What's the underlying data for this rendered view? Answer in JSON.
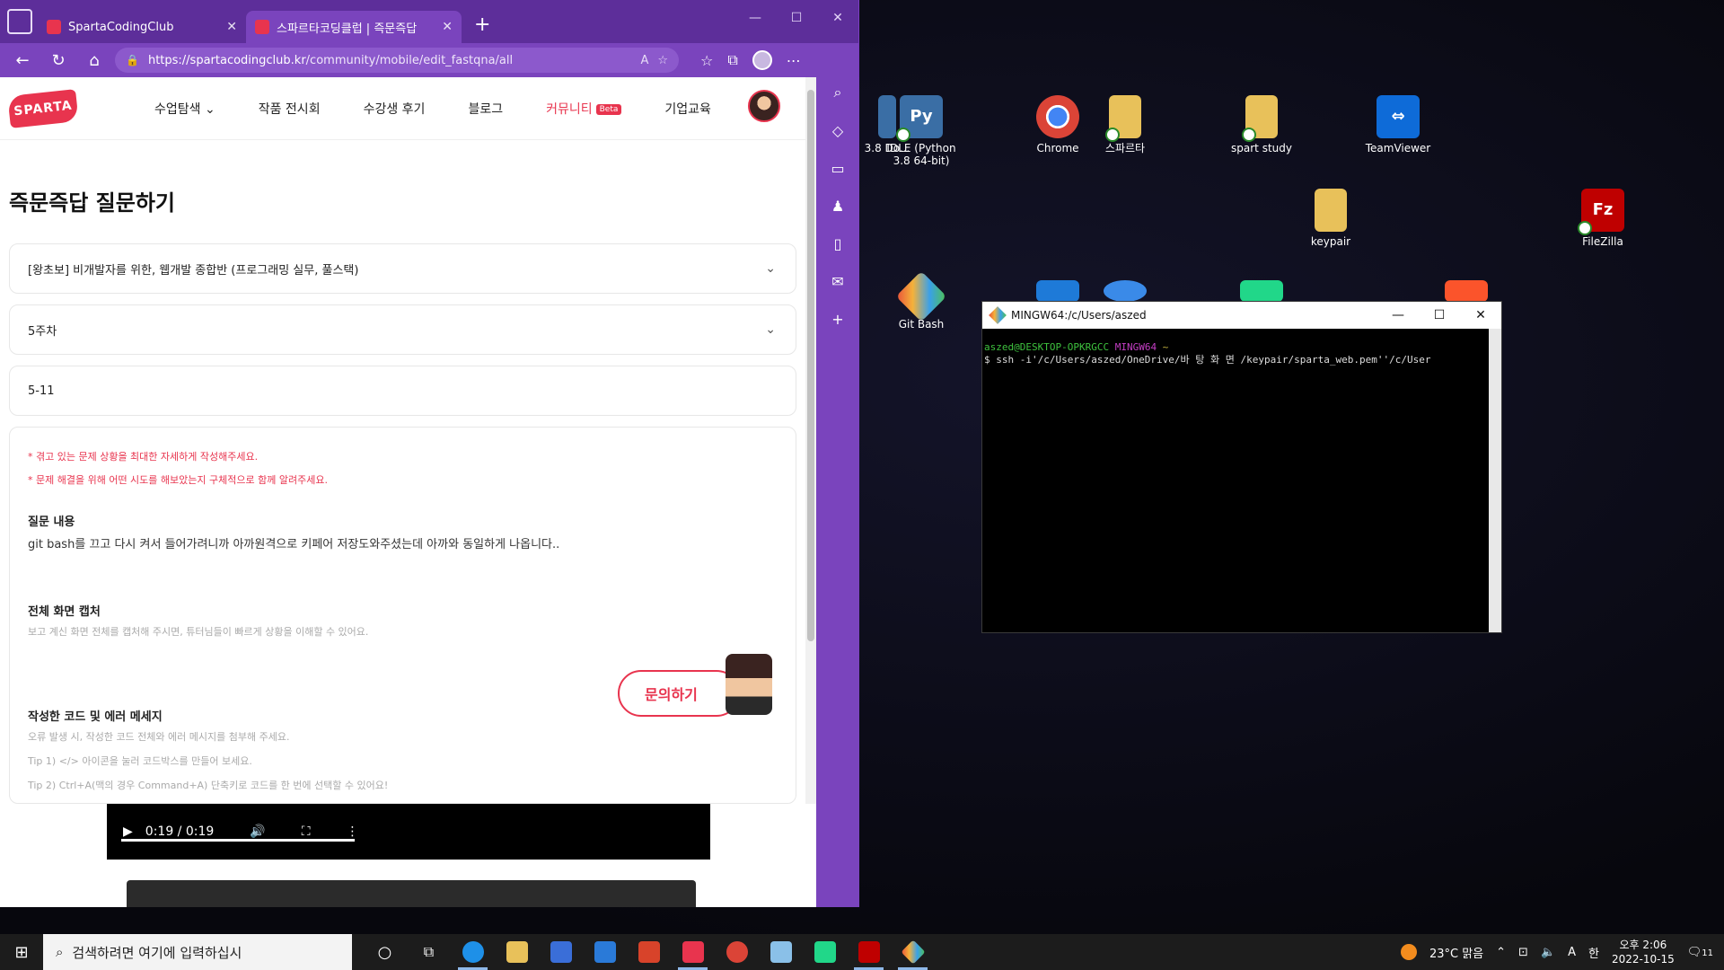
{
  "browser": {
    "tabs": [
      {
        "label": "SpartaCodingClub",
        "active": false
      },
      {
        "label": "스파르타코딩클럽 | 즉문즉답",
        "active": true
      }
    ],
    "url_host": "https://spartacodingclub.kr",
    "url_path": "/community/mobile/edit_fastqna/all"
  },
  "site": {
    "logo": "SPARTA",
    "nav": [
      {
        "label": "수업탐색"
      },
      {
        "label": "작품 전시회"
      },
      {
        "label": "수강생 후기"
      },
      {
        "label": "블로그"
      },
      {
        "label": "커뮤니티",
        "badge": "Beta"
      },
      {
        "label": "기업교육"
      }
    ]
  },
  "form": {
    "title": "즉문즉답 질문하기",
    "course": "[왕초보] 비개발자를 위한, 웹개발 종합반 (프로그래밍 실무, 풀스택)",
    "week": "5주차",
    "lesson": "5-11",
    "warnings": [
      "* 겪고 있는 문제 상황을 최대한 자세하게 작성해주세요.",
      "* 문제 해결을 위해 어떤 시도를 해보았는지 구체적으로 함께 알려주세요."
    ],
    "question_heading": "질문 내용",
    "question_text": "git bash를 끄고 다시 켜서 들어가려니까 아까원격으로 키페어 저장도와주셨는데 아까와 동일하게 나옵니다..",
    "capture_heading": "전체 화면 캡처",
    "capture_hint": "보고 계신 화면 전체를 캡처해 주시면, 튜터님들이 빠르게 상황을 이해할 수 있어요.",
    "code_heading": "작성한 코드 및 에러 메세지",
    "code_hints": [
      "오류 발생 시, 작성한 코드 전체와 에러 메시지를 첨부해 주세요.",
      "Tip 1) </> 아이콘을 눌러 코드박스를 만들어 보세요.",
      "Tip 2) Ctrl+A(맥의 경우 Command+A) 단축키로 코드를 한 번에 선택할 수 있어요!"
    ],
    "ask_button": "문의하기"
  },
  "video": {
    "time": "0:19 / 0:19"
  },
  "desktop_icons": [
    {
      "label": "3.8 Do...",
      "color": "#3a6ea5"
    },
    {
      "label": "IDLE (Python 3.8 64-bit)",
      "color": "#3a6ea5"
    },
    {
      "label": "Chrome",
      "color": "#db4437"
    },
    {
      "label": "스파르타",
      "color": "#e8c15a"
    },
    {
      "label": "spart study",
      "color": "#e8c15a"
    },
    {
      "label": "TeamViewer",
      "color": "#0e6bd8"
    },
    {
      "label": "keypair",
      "color": "#e8c15a"
    },
    {
      "label": "FileZilla",
      "color": "#bf0000"
    },
    {
      "label": "Git Bash",
      "color": "#e84e3a"
    }
  ],
  "terminal": {
    "title": "MINGW64:/c/Users/aszed",
    "prompt_user": "aszed@DESKTOP-OPKRGCC",
    "prompt_host": "MINGW64",
    "prompt_path": "~",
    "command": "$ ssh -i'/c/Users/aszed/OneDrive/바 탕  화 면 /keypair/sparta_web.pem''/c/User"
  },
  "taskbar": {
    "search_placeholder": "검색하려면 여기에 입력하십시",
    "weather": "23°C  맑음",
    "time": "오후 2:06",
    "date": "2022-10-15",
    "lang": "한",
    "notif": "11"
  }
}
